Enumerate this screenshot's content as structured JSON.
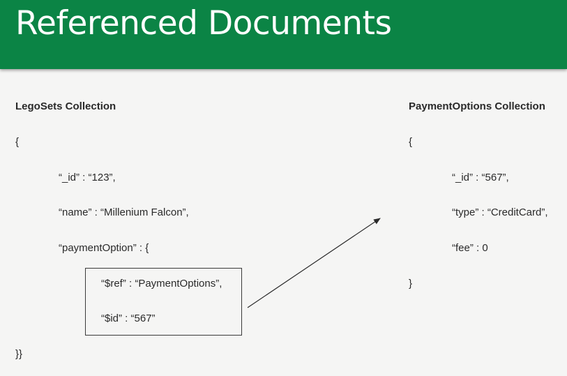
{
  "header": {
    "title": "Referenced Documents"
  },
  "lego": {
    "heading": "LegoSets Collection",
    "open": "{",
    "id_line": "“_id” : “123”,",
    "name_line": "“name” : “Millenium Falcon”,",
    "payment_line": "“paymentOption” : {",
    "ref_line": "“$ref” : “PaymentOptions”,",
    "refid_line": "“$id” : “567”",
    "close": "}}"
  },
  "payment": {
    "heading": "PaymentOptions Collection",
    "open": "{",
    "id_line": "“_id” : “567”,",
    "type_line": "“type” : “CreditCard”,",
    "fee_line": "“fee” : 0",
    "close": "}"
  },
  "colors": {
    "banner": "#0b8445",
    "background": "#f5f5f4",
    "text": "#2a2a2a"
  }
}
